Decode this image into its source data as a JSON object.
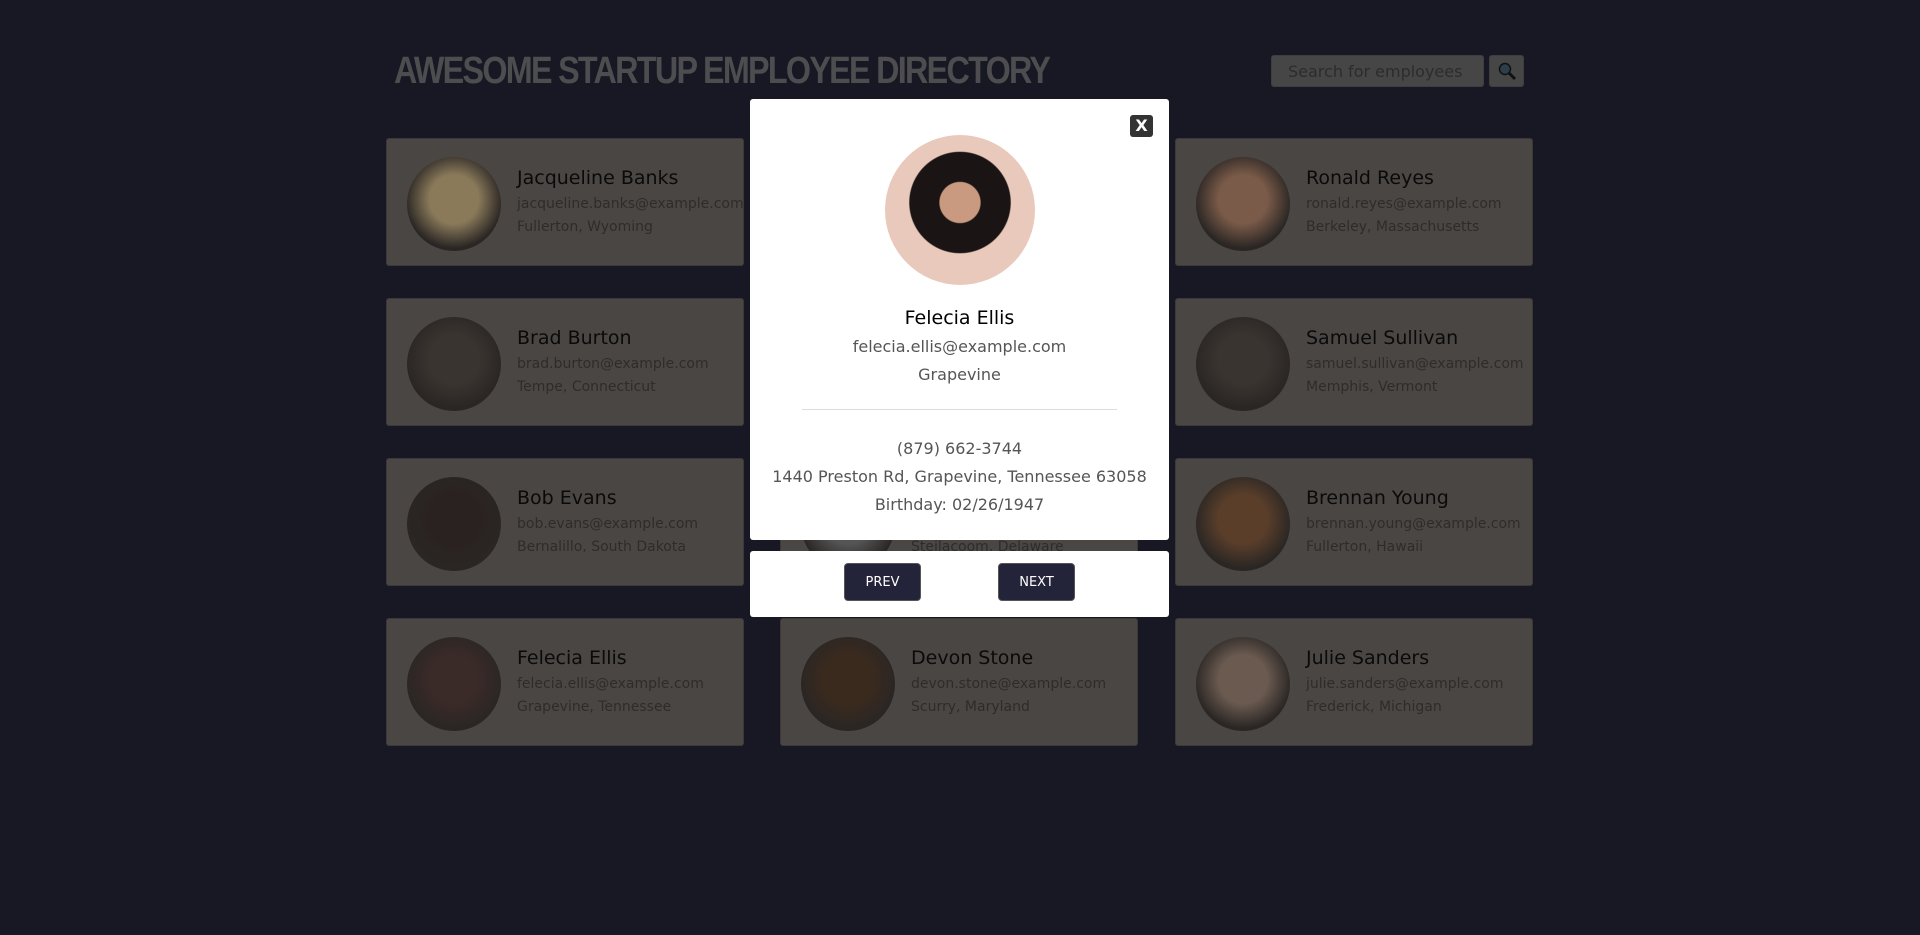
{
  "header": {
    "title": "AWESOME STARTUP EMPLOYEE DIRECTORY",
    "search_placeholder": "Search for employees",
    "search_icon": "magnifier-icon"
  },
  "employees": [
    {
      "name": "Jacqueline Banks",
      "email": "jacqueline.banks@example.com",
      "location": "Fullerton, Wyoming",
      "color": "#8a7a5a"
    },
    {
      "name": "",
      "email": "",
      "location": "",
      "color": "#555"
    },
    {
      "name": "Ronald Reyes",
      "email": "ronald.reyes@example.com",
      "location": "Berkeley, Massachusetts",
      "color": "#7a5a48"
    },
    {
      "name": "Brad Burton",
      "email": "brad.burton@example.com",
      "location": "Tempe, Connecticut",
      "color": "#3a3430"
    },
    {
      "name": "",
      "email": "",
      "location": "",
      "color": "#555"
    },
    {
      "name": "Samuel Sullivan",
      "email": "samuel.sullivan@example.com",
      "location": "Memphis, Vermont",
      "color": "#3a3430"
    },
    {
      "name": "Bob Evans",
      "email": "bob.evans@example.com",
      "location": "Bernalillo, South Dakota",
      "color": "#2a2220"
    },
    {
      "name": "",
      "email": "",
      "location": "Steilacoom, Delaware",
      "color": "#555"
    },
    {
      "name": "Brennan Young",
      "email": "brennan.young@example.com",
      "location": "Fullerton, Hawaii",
      "color": "#5a3e2a"
    },
    {
      "name": "Felecia Ellis",
      "email": "felecia.ellis@example.com",
      "location": "Grapevine, Tennessee",
      "color": "#3a2a28"
    },
    {
      "name": "Devon Stone",
      "email": "devon.stone@example.com",
      "location": "Scurry, Maryland",
      "color": "#3a2a1e"
    },
    {
      "name": "Julie Sanders",
      "email": "julie.sanders@example.com",
      "location": "Frederick, Michigan",
      "color": "#6a5a50"
    }
  ],
  "modal": {
    "close_label": "X",
    "name": "Felecia Ellis",
    "email": "felecia.ellis@example.com",
    "city": "Grapevine",
    "phone": "(879) 662-3744",
    "address": "1440 Preston Rd, Grapevine, Tennessee 63058",
    "birthday": "Birthday: 02/26/1947",
    "prev_label": "PREV",
    "next_label": "NEXT"
  }
}
